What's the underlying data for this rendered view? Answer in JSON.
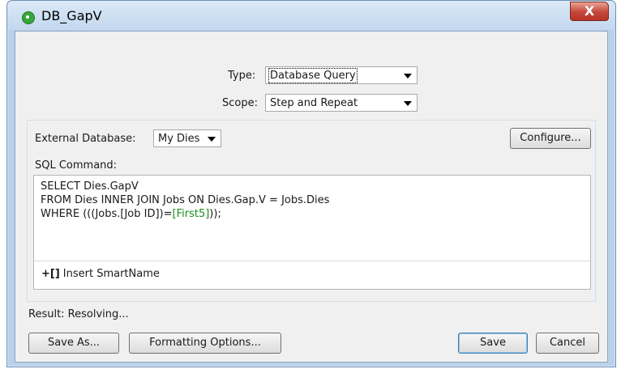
{
  "window": {
    "title": "DB_GapV",
    "close_symbol": "X"
  },
  "type": {
    "label": "Type:",
    "value": "Database Query"
  },
  "scope": {
    "label": "Scope:",
    "value": "Step and Repeat"
  },
  "external_db": {
    "label": "External Database:",
    "value": "My Dies"
  },
  "configure_label": "Configure...",
  "sql": {
    "label": "SQL Command:",
    "line1": "SELECT Dies.GapV",
    "line2": "FROM Dies INNER JOIN Jobs ON Dies.Gap.V = Jobs.Dies",
    "line3_prefix": "WHERE (((Jobs.[Job ID])=",
    "line3_smartname": "[First5]",
    "line3_suffix": "));"
  },
  "insert_smartname": {
    "icon": "+[]",
    "label": "Insert SmartName"
  },
  "result_text": "Result: Resolving...",
  "buttons": {
    "save_as": "Save As...",
    "formatting_options": "Formatting Options...",
    "save": "Save",
    "cancel": "Cancel"
  }
}
